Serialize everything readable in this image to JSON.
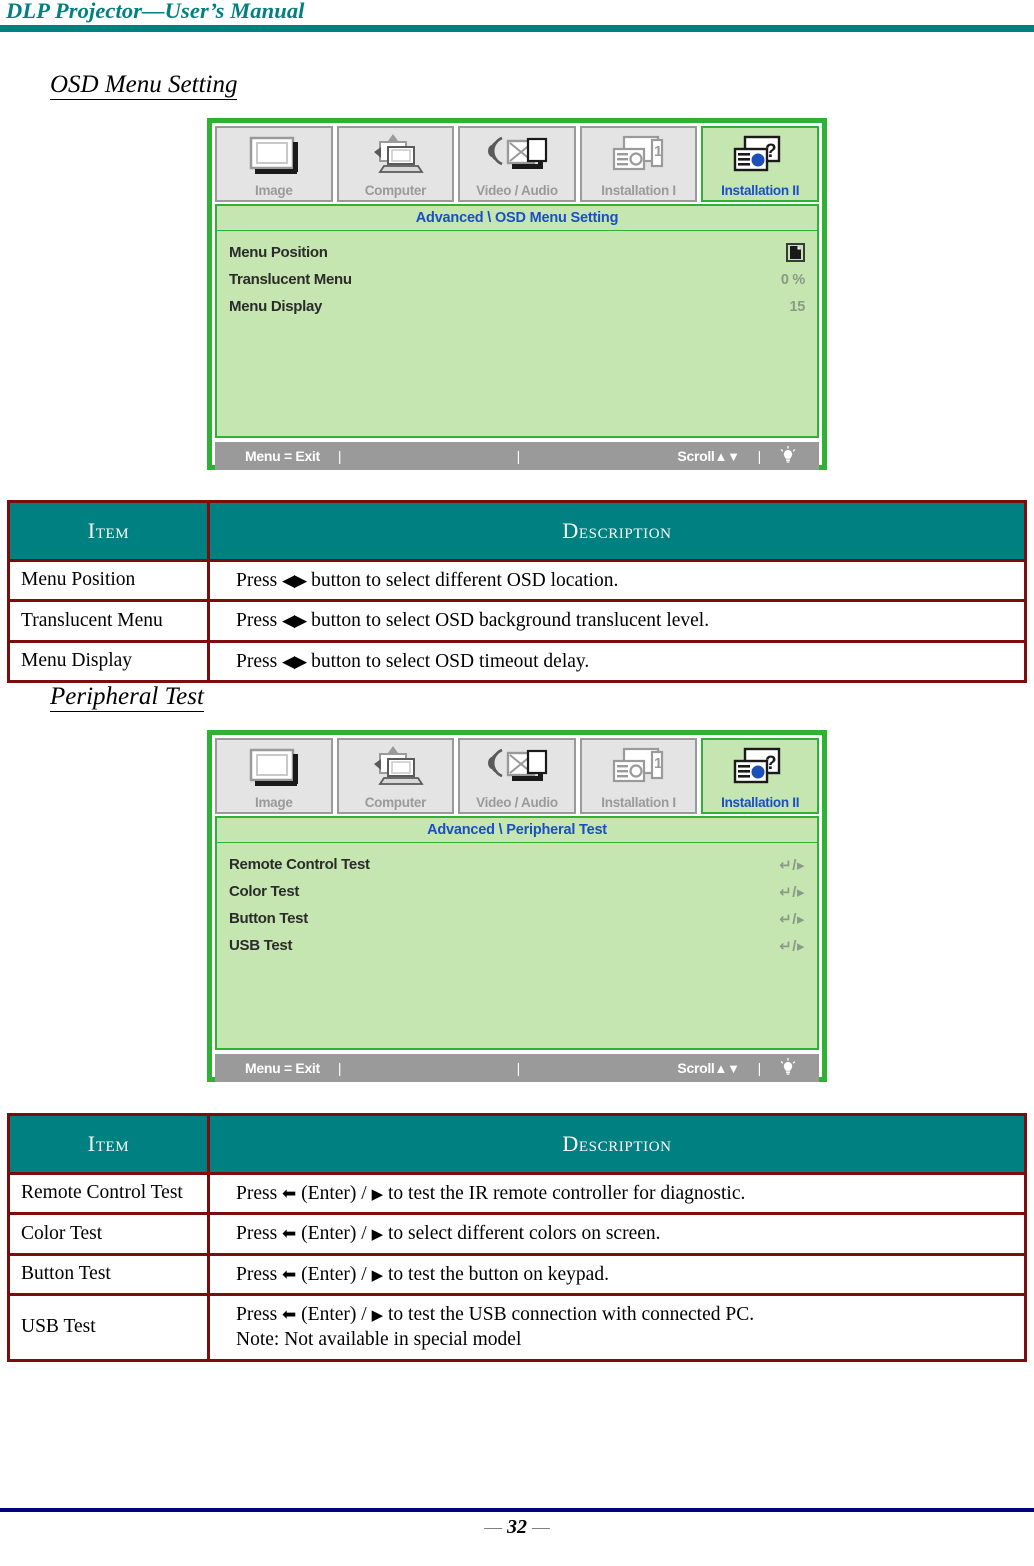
{
  "header": {
    "title": "DLP Projector—User’s Manual",
    "rule_color": "#00807f"
  },
  "sections": [
    {
      "heading": "OSD Menu Setting"
    },
    {
      "heading": "Peripheral Test"
    }
  ],
  "osd_menus": [
    {
      "tabs": [
        {
          "label": "Image",
          "icon": "screen-icon",
          "active": false
        },
        {
          "label": "Computer",
          "icon": "laptop-icon",
          "active": false
        },
        {
          "label": "Video / Audio",
          "icon": "video-audio-icon",
          "active": false
        },
        {
          "label": "Installation I",
          "icon": "installation-one-icon",
          "active": false
        },
        {
          "label": "Installation II",
          "icon": "installation-two-icon",
          "active": true
        }
      ],
      "subtitle": "Advanced \\ OSD Menu Setting",
      "rows": [
        {
          "label": "Menu Position",
          "value": "",
          "value_type": "position-icon"
        },
        {
          "label": "Translucent Menu",
          "value": "0 %",
          "value_type": "text"
        },
        {
          "label": "Menu Display",
          "value": "15",
          "value_type": "text"
        }
      ],
      "footer": {
        "exit": "Menu = Exit",
        "separator": "|",
        "scroll": "Scroll",
        "scroll_arrows": "▲▼",
        "lamp_icon": "lamp-icon"
      }
    },
    {
      "tabs": [
        {
          "label": "Image",
          "icon": "screen-icon",
          "active": false
        },
        {
          "label": "Computer",
          "icon": "laptop-icon",
          "active": false
        },
        {
          "label": "Video / Audio",
          "icon": "video-audio-icon",
          "active": false
        },
        {
          "label": "Installation I",
          "icon": "installation-one-icon",
          "active": false
        },
        {
          "label": "Installation II",
          "icon": "installation-two-icon",
          "active": true
        }
      ],
      "subtitle": "Advanced \\ Peripheral Test",
      "rows": [
        {
          "label": "Remote Control Test",
          "value": "↵/▸",
          "value_type": "enter-arrow"
        },
        {
          "label": "Color Test",
          "value": "↵/▸",
          "value_type": "enter-arrow"
        },
        {
          "label": "Button Test",
          "value": "↵/▸",
          "value_type": "enter-arrow"
        },
        {
          "label": "USB Test",
          "value": "↵/▸",
          "value_type": "enter-arrow"
        }
      ],
      "footer": {
        "exit": "Menu = Exit",
        "separator": "|",
        "scroll": "Scroll",
        "scroll_arrows": "▲▼",
        "lamp_icon": "lamp-icon"
      }
    }
  ],
  "tables": [
    {
      "headers": {
        "item": "Item",
        "description": "Description"
      },
      "rows": [
        {
          "item": "Menu Position",
          "desc_pre": "Press ",
          "desc_glyph": "◀▶",
          "desc_post": " button to select different OSD location.",
          "desc_note": ""
        },
        {
          "item": "Translucent Menu",
          "desc_pre": "Press ",
          "desc_glyph": "◀▶",
          "desc_post": " button to select OSD background translucent level.",
          "desc_note": ""
        },
        {
          "item": "Menu Display",
          "desc_pre": "Press ",
          "desc_glyph": "◀▶",
          "desc_post": " button to select OSD timeout delay.",
          "desc_note": ""
        }
      ]
    },
    {
      "headers": {
        "item": "Item",
        "description": "Description"
      },
      "rows": [
        {
          "item": "Remote Control Test",
          "desc_pre": "Press ",
          "desc_glyph": "⬅",
          "desc_mid": " (Enter) / ",
          "desc_glyph2": "▶",
          "desc_post": " to test the IR remote controller for diagnostic.",
          "desc_note": ""
        },
        {
          "item": "Color Test",
          "desc_pre": "Press ",
          "desc_glyph": "⬅",
          "desc_mid": " (Enter) / ",
          "desc_glyph2": "▶",
          "desc_post": " to select different colors on screen.",
          "desc_note": ""
        },
        {
          "item": "Button Test",
          "desc_pre": "Press ",
          "desc_glyph": "⬅",
          "desc_mid": " (Enter) / ",
          "desc_glyph2": "▶",
          "desc_post": " to test the button on keypad.",
          "desc_note": ""
        },
        {
          "item": "USB Test",
          "desc_pre": "Press ",
          "desc_glyph": "⬅",
          "desc_mid": " (Enter) / ",
          "desc_glyph2": "▶",
          "desc_post": " to test the USB connection with connected PC.",
          "desc_note": "Note: Not available in special model"
        }
      ]
    }
  ],
  "footer": {
    "page_number": "32",
    "dash_left": "—",
    "dash_right": "—",
    "rule_color": "#000080"
  },
  "colors": {
    "teal": "#008080",
    "dark_red_border": "#7b0d0d",
    "osd_green_border": "#2eb135",
    "osd_green_fill": "#c5e6b0",
    "osd_blue_text": "#1a4fc4",
    "navy_rule": "#000080"
  }
}
